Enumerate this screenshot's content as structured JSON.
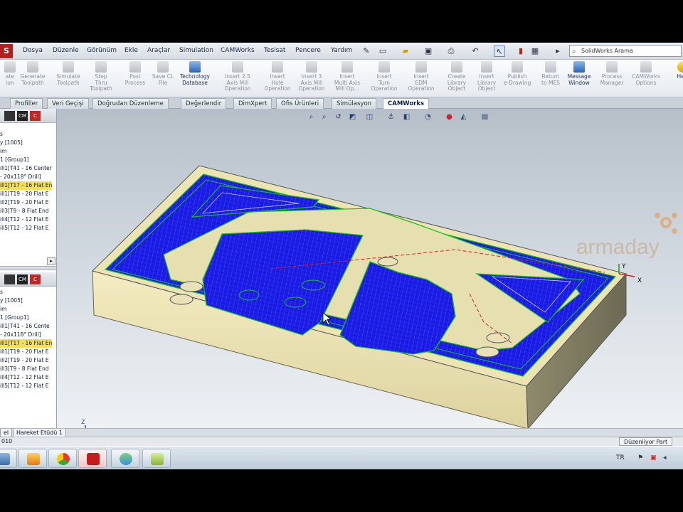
{
  "menubar": {
    "logo": "S",
    "items": [
      "Dosya",
      "Düzenle",
      "Görünüm",
      "Ekle",
      "Araçlar",
      "Simulation",
      "CAMWorks",
      "Tesisat",
      "Pencere",
      "Yardım"
    ],
    "search_placeholder": "SolidWorks Arama"
  },
  "ribbon": {
    "buttons": [
      {
        "l1": "ate",
        "l2": "ion",
        "l3": "",
        "enabled": false,
        "icon": "extract-icon"
      },
      {
        "l1": "Generate",
        "l2": "Toolpath",
        "l3": "",
        "enabled": false,
        "icon": "toolpath-icon"
      },
      {
        "l1": "Simulate",
        "l2": "Toolpath",
        "l3": "",
        "enabled": false,
        "icon": "simulate-icon"
      },
      {
        "l1": "Step",
        "l2": "Thru",
        "l3": "Toolpath",
        "enabled": false,
        "icon": "step-icon"
      },
      {
        "l1": "Post",
        "l2": "Process",
        "l3": "",
        "enabled": false,
        "icon": "post-icon"
      },
      {
        "l1": "Save CL",
        "l2": "File",
        "l3": "",
        "enabled": false,
        "icon": "save-cl-icon"
      },
      {
        "l1": "Technology",
        "l2": "Database",
        "l3": "",
        "enabled": true,
        "icon": "database-icon"
      },
      {
        "l1": "Insert 2.5",
        "l2": "Axis Mill",
        "l3": "Operation",
        "enabled": false,
        "icon": "mill25-icon"
      },
      {
        "l1": "Insert",
        "l2": "Hole",
        "l3": "Operation",
        "enabled": false,
        "icon": "hole-icon"
      },
      {
        "l1": "Insert 3",
        "l2": "Axis Mill",
        "l3": "Operation",
        "enabled": false,
        "icon": "mill3-icon"
      },
      {
        "l1": "Insert",
        "l2": "Multi Axis",
        "l3": "Mill Op...",
        "enabled": false,
        "icon": "multiaxis-icon"
      },
      {
        "l1": "Insert",
        "l2": "Turn",
        "l3": "Operation",
        "enabled": false,
        "icon": "turn-icon"
      },
      {
        "l1": "Insert",
        "l2": "EDM",
        "l3": "Operation",
        "enabled": false,
        "icon": "edm-icon"
      },
      {
        "l1": "Create",
        "l2": "Library",
        "l3": "Object",
        "enabled": false,
        "icon": "create-library-icon"
      },
      {
        "l1": "Insert",
        "l2": "Library",
        "l3": "Object",
        "enabled": false,
        "icon": "insert-library-icon"
      },
      {
        "l1": "Publish",
        "l2": "e-Drawing",
        "l3": "",
        "enabled": false,
        "icon": "edrawing-icon"
      },
      {
        "l1": "Return",
        "l2": "to MES",
        "l3": "",
        "enabled": false,
        "icon": "return-icon"
      },
      {
        "l1": "Message",
        "l2": "Window",
        "l3": "",
        "enabled": true,
        "icon": "message-icon"
      },
      {
        "l1": "Process",
        "l2": "Manager",
        "l3": "",
        "enabled": false,
        "icon": "process-icon"
      },
      {
        "l1": "CAMWorks",
        "l2": "Options",
        "l3": "",
        "enabled": false,
        "icon": "options-icon"
      },
      {
        "l1": "Help",
        "l2": "",
        "l3": "",
        "enabled": true,
        "icon": "help-icon"
      }
    ]
  },
  "tabs": [
    "Profiller",
    "Veri Geçişi",
    "Doğrudan Düzenleme",
    "Değerlendir",
    "DimXpert",
    "Ofis Ürünleri",
    "Simülasyon",
    "CAMWorks"
  ],
  "active_tab": "CAMWorks",
  "tree_top": [
    "s",
    "y [1005]",
    "im",
    "1 [Group1]",
    "ill1[T41 - 16 Center",
    "- 20x118° Drill]",
    "ill1[T17 - 16 Flat En",
    "ill1[T19 - 20 Flat E",
    "ill2[T19 - 20 Flat E",
    "ill3[T9 - 8 Flat End",
    "ill4[T12 - 12 Flat E",
    "ill5[T12 - 12 Flat E"
  ],
  "tree_bottom": [
    "s",
    "y [1005]",
    "im",
    "1 [Group1]",
    "ill1[T41 - 16 Cente",
    "- 20x118° Drill]",
    "ill1[T17 - 16 Flat En",
    "ill1[T19 - 20 Flat E",
    "ill2[T19 - 20 Flat E",
    "ill3[T9 - 8 Flat End",
    "ill4[T12 - 12 Flat E",
    "ill5[T12 - 12 Flat E"
  ],
  "panel_buttons": [
    "CM",
    "C"
  ],
  "watermark": "armaday",
  "triad": {
    "x": "X",
    "y": "Y",
    "z": "Z"
  },
  "model_tabs": [
    "el",
    "Hareket Etüdü 1"
  ],
  "status": {
    "left": "010",
    "right": "Düzenliyor Part"
  },
  "taskbar": {
    "apps": [
      "windows-explorer-icon",
      "media-player-icon",
      "chrome-icon",
      "solidworks-icon",
      "messenger-icon",
      "notes-icon"
    ],
    "lang": "TR"
  },
  "colors": {
    "toolpath": "#1f1fe0",
    "stock": "#ede6b6",
    "outline": "#18c018",
    "rapid": "#e02020"
  }
}
